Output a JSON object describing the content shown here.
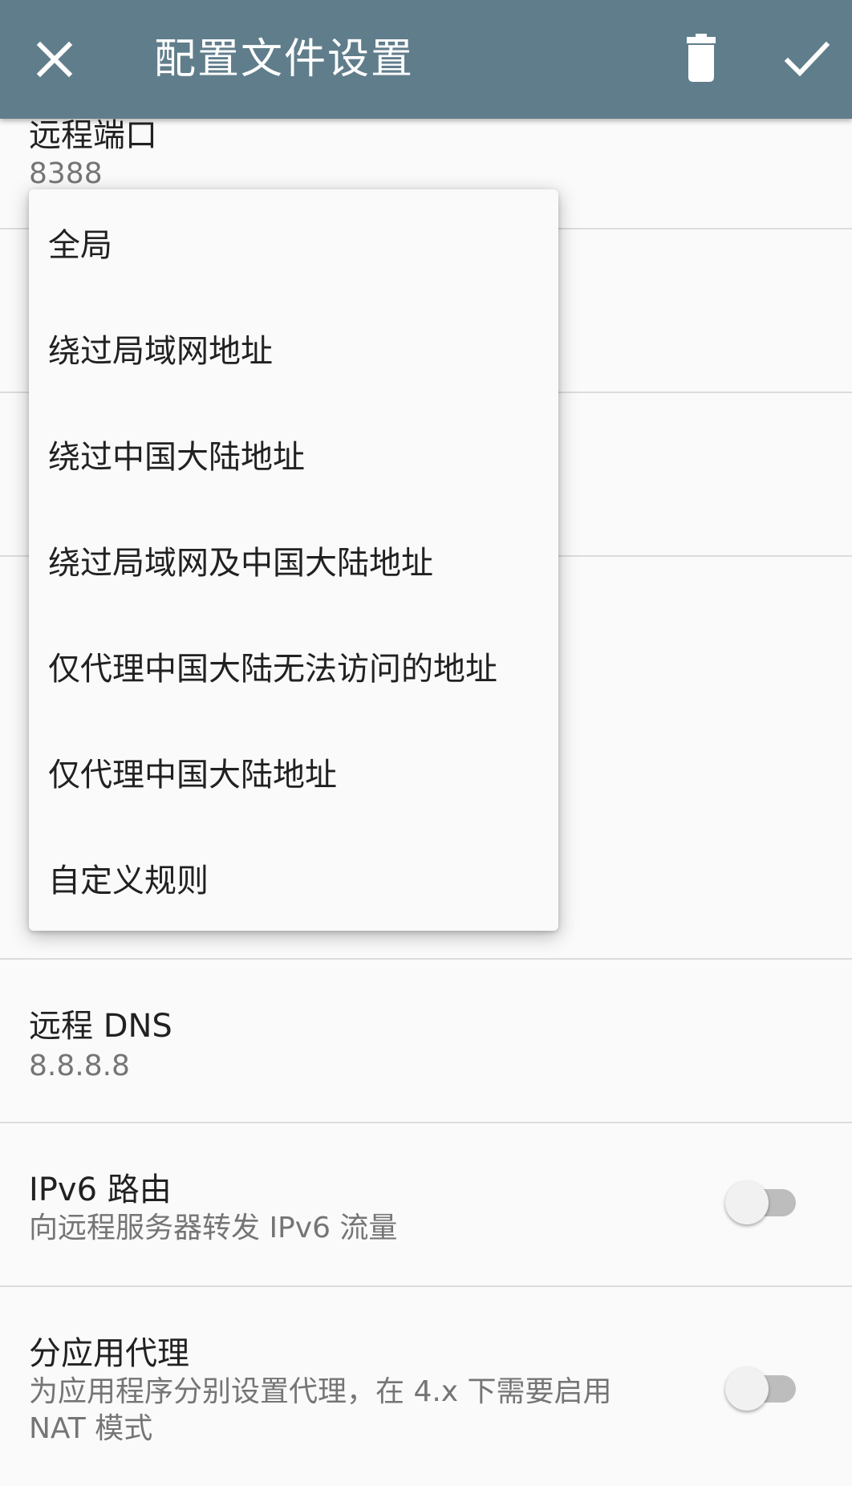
{
  "appbar": {
    "title": "配置文件设置",
    "close_icon": "close-icon",
    "delete_icon": "delete-icon",
    "confirm_icon": "check-icon",
    "background": "#607d8b"
  },
  "prefs": {
    "remote_port": {
      "title": "远程端口",
      "value": "8388"
    },
    "remote_dns": {
      "title": "远程 DNS",
      "value": "8.8.8.8"
    },
    "ipv6": {
      "title": "IPv6 路由",
      "summary": "向远程服务器转发 IPv6 流量",
      "enabled": false
    },
    "per_app": {
      "title": "分应用代理",
      "summary_line1": "为应用程序分别设置代理，在 4.x 下需要启用",
      "summary_line2": "NAT 模式",
      "enabled": false
    }
  },
  "route_menu": {
    "items": [
      "全局",
      "绕过局域网地址",
      "绕过中国大陆地址",
      "绕过局域网及中国大陆地址",
      "仅代理中国大陆无法访问的地址",
      "仅代理中国大陆地址",
      "自定义规则"
    ]
  }
}
